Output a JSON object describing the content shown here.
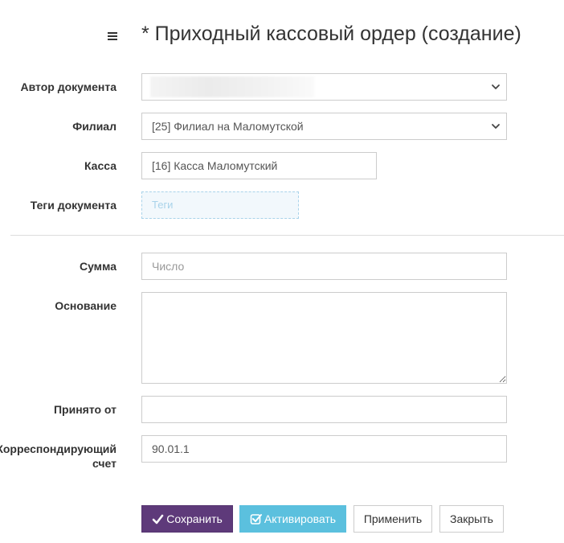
{
  "header": {
    "menu_icon": "hamburger-menu-icon",
    "title": "* Приходный кассовый ордер (создание)"
  },
  "form": {
    "author": {
      "label": "Автор документа",
      "value": ""
    },
    "branch": {
      "label": "Филиал",
      "value": "[25] Филиал на Маломутской"
    },
    "cashbox": {
      "label": "Касса",
      "value": "[16] Касса Маломутский"
    },
    "tags": {
      "label": "Теги документа",
      "placeholder": "Теги"
    },
    "amount": {
      "label": "Сумма",
      "placeholder": "Число",
      "value": ""
    },
    "basis": {
      "label": "Основание",
      "value": ""
    },
    "received_from": {
      "label": "Принято от",
      "value": ""
    },
    "corr_account": {
      "label_line1": "Корреспондирующий",
      "label_line2": "счет",
      "value": "90.01.1"
    }
  },
  "buttons": {
    "save": "Сохранить",
    "activate": "Активировать",
    "apply": "Применить",
    "close": "Закрыть"
  },
  "colors": {
    "save_bg": "#5e3a7a",
    "activate_bg": "#5bc0de",
    "tags_border": "#a9d3ea"
  }
}
